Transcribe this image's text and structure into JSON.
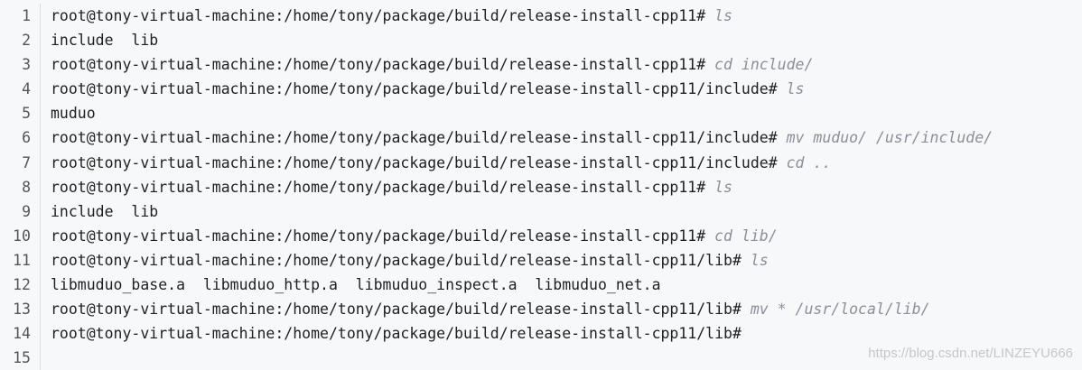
{
  "code": {
    "line_numbers": [
      "1",
      "2",
      "3",
      "4",
      "5",
      "6",
      "7",
      "8",
      "9",
      "10",
      "11",
      "12",
      "13",
      "14",
      "15"
    ],
    "lines": [
      {
        "prompt": "root@tony-virtual-machine:/home/tony/package/build/release-install-cpp11#",
        "command": " ls"
      },
      {
        "prompt": "include  lib",
        "command": ""
      },
      {
        "prompt": "root@tony-virtual-machine:/home/tony/package/build/release-install-cpp11#",
        "command": " cd include/"
      },
      {
        "prompt": "root@tony-virtual-machine:/home/tony/package/build/release-install-cpp11/include#",
        "command": " ls"
      },
      {
        "prompt": "muduo",
        "command": ""
      },
      {
        "prompt": "root@tony-virtual-machine:/home/tony/package/build/release-install-cpp11/include#",
        "command": " mv muduo/ /usr/include/"
      },
      {
        "prompt": "root@tony-virtual-machine:/home/tony/package/build/release-install-cpp11/include#",
        "command": " cd .."
      },
      {
        "prompt": "root@tony-virtual-machine:/home/tony/package/build/release-install-cpp11#",
        "command": " ls"
      },
      {
        "prompt": "include  lib",
        "command": ""
      },
      {
        "prompt": "root@tony-virtual-machine:/home/tony/package/build/release-install-cpp11#",
        "command": " cd lib/"
      },
      {
        "prompt": "root@tony-virtual-machine:/home/tony/package/build/release-install-cpp11/lib#",
        "command": " ls"
      },
      {
        "prompt": "libmuduo_base.a  libmuduo_http.a  libmuduo_inspect.a  libmuduo_net.a",
        "command": ""
      },
      {
        "prompt": "root@tony-virtual-machine:/home/tony/package/build/release-install-cpp11/lib#",
        "command": " mv * /usr/local/lib/"
      },
      {
        "prompt": "root@tony-virtual-machine:/home/tony/package/build/release-install-cpp11/lib#",
        "command": ""
      },
      {
        "prompt": "",
        "command": ""
      }
    ]
  },
  "watermark": "https://blog.csdn.net/LINZEYU666"
}
